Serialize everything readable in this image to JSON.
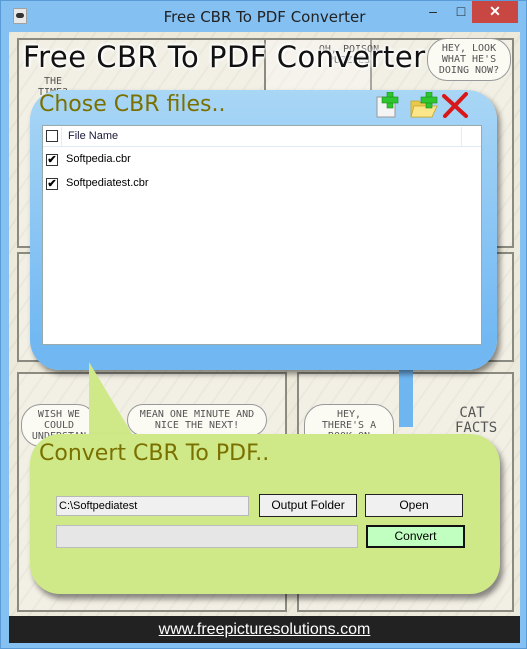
{
  "window": {
    "title": "Free CBR To PDF Converter",
    "controls": {
      "minimize": "–",
      "maximize": "□",
      "close": "✕"
    }
  },
  "app": {
    "heading": "Free CBR To PDF Converter"
  },
  "comic": {
    "bubbles": [
      "HEY, LOOK WHAT HE'S DOING NOW?",
      "OH, POISON PUZZLES",
      "THE TIME?",
      "WISH WE COULD UNDERSTAN",
      "MEAN ONE MINUTE AND NICE THE NEXT!",
      "HEY, THERE'S A BOOK ON CATS!",
      "CAT FACTS"
    ]
  },
  "chose_section": {
    "title": "Chose CBR files..",
    "toolbar": [
      {
        "icon": "add-file-icon",
        "action": "add-file"
      },
      {
        "icon": "add-folder-icon",
        "action": "add-folder"
      },
      {
        "icon": "remove-icon",
        "action": "remove"
      }
    ],
    "list": {
      "columns": [
        "File Name"
      ],
      "header_checked": false,
      "rows": [
        {
          "name": "Softpedia.cbr",
          "checked": true
        },
        {
          "name": "Softpediatest.cbr",
          "checked": true
        }
      ]
    }
  },
  "convert_section": {
    "title": "Convert CBR To PDF..",
    "output_folder_value": "C:\\Softpediatest",
    "output_folder_button": "Output Folder",
    "open_button": "Open",
    "convert_button": "Convert",
    "progress_percent": 0
  },
  "footer": {
    "link_text": "www.freepicturesolutions.com"
  },
  "colors": {
    "section_title": "#7a7000",
    "blue_panel": "#71b8f3",
    "green_panel": "#cfe989",
    "convert_button_bg": "#c0ffc0",
    "close_button": "#c84743",
    "footer_bg": "#222222"
  }
}
